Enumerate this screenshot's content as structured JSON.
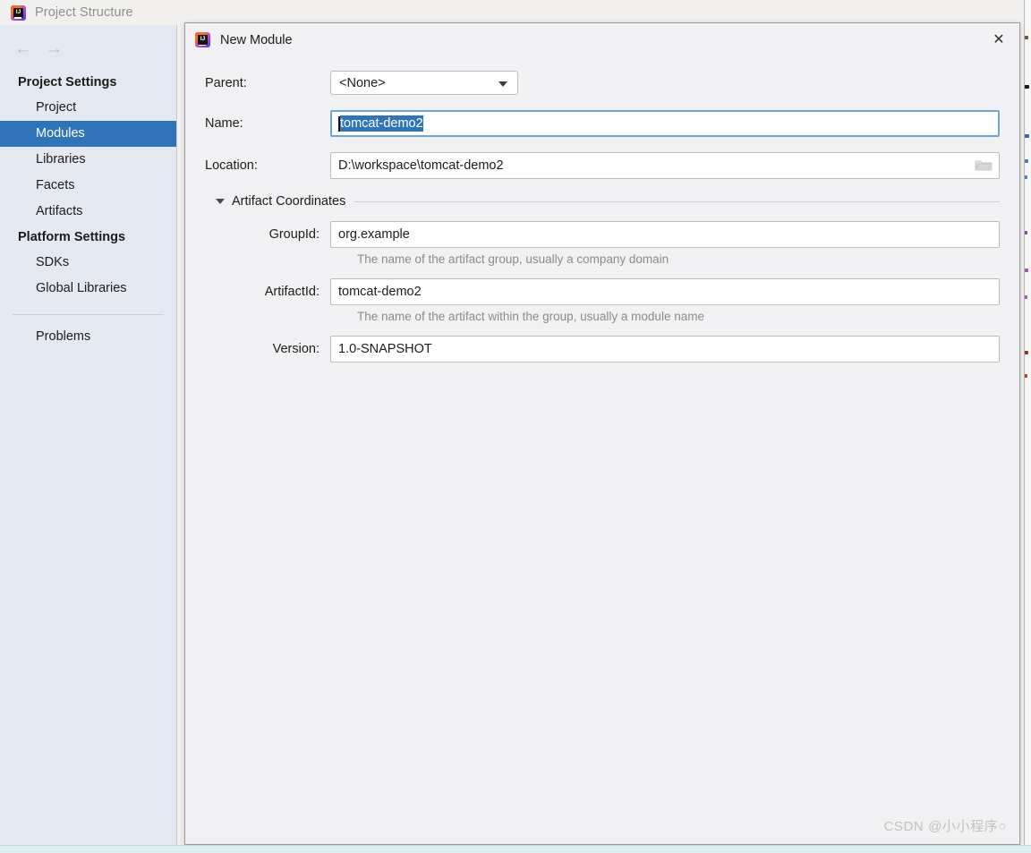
{
  "background_window": {
    "title": "Project Structure",
    "logo_icon": "intellij-idea-logo",
    "nav": {
      "back_icon": "arrow-left-icon",
      "forward_icon": "arrow-right-icon"
    },
    "sidebar": {
      "groups": [
        {
          "header": "Project Settings",
          "items": [
            {
              "label": "Project",
              "selected": false
            },
            {
              "label": "Modules",
              "selected": true
            },
            {
              "label": "Libraries",
              "selected": false
            },
            {
              "label": "Facets",
              "selected": false
            },
            {
              "label": "Artifacts",
              "selected": false
            }
          ]
        },
        {
          "header": "Platform Settings",
          "items": [
            {
              "label": "SDKs",
              "selected": false
            },
            {
              "label": "Global Libraries",
              "selected": false
            }
          ]
        }
      ],
      "footer_items": [
        {
          "label": "Problems"
        }
      ],
      "selected_color": "#2f74b8"
    }
  },
  "dialog": {
    "title": "New Module",
    "logo_icon": "intellij-idea-logo",
    "close_icon": "close-icon",
    "fields": {
      "parent": {
        "label": "Parent:",
        "value": "<None>",
        "chevron_icon": "chevron-down-icon"
      },
      "name": {
        "label": "Name:",
        "value": "tomcat-demo2",
        "selected": true,
        "focused": true
      },
      "location": {
        "label": "Location:",
        "value": "D:\\workspace\\tomcat-demo2",
        "browse_icon": "folder-open-icon"
      }
    },
    "artifact_section": {
      "title": "Artifact Coordinates",
      "expanded": true,
      "collapse_icon": "triangle-down-icon",
      "fields": [
        {
          "label": "GroupId:",
          "value": "org.example",
          "hint": "The name of the artifact group, usually a company domain"
        },
        {
          "label": "ArtifactId:",
          "value": "tomcat-demo2",
          "hint": "The name of the artifact within the group, usually a module name"
        },
        {
          "label": "Version:",
          "value": "1.0-SNAPSHOT",
          "hint": ""
        }
      ]
    },
    "watermark": "CSDN @小小程序○"
  },
  "colors": {
    "accent": "#2f74b8",
    "dialog_bg": "#f1f0f2",
    "sidebar_bg": "#e4e8f0",
    "hint_text": "#8c8c8c"
  }
}
